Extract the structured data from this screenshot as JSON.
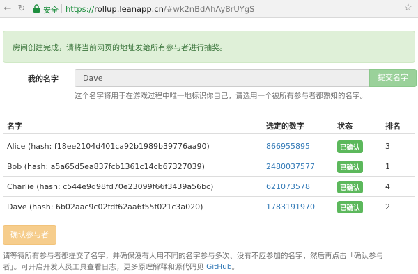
{
  "browser": {
    "secure_label": "安全",
    "url_protocol": "https://",
    "url_domain": "rollup.leanapp.cn",
    "url_hash": "/#wk2nBdAhAy8rUYgS"
  },
  "alert": {
    "text": "房间创建完成，请将当前网页的地址发给所有参与者进行抽奖。"
  },
  "form": {
    "name_label": "我的名字",
    "name_value": "Dave",
    "submit_label": "提交名字",
    "help_text": "这个名字将用于在游戏过程中唯一地标识你自己，请选用一个被所有参与者都熟知的名字。"
  },
  "table": {
    "headers": {
      "name": "名字",
      "number": "选定的数字",
      "status": "状态",
      "rank": "排名"
    },
    "rows": [
      {
        "name": "Alice (hash: f18ee2104d401ca92b1989b39776aa90)",
        "number": "866955895",
        "status": "已确认",
        "rank": "3"
      },
      {
        "name": "Bob (hash: a5a65d5ea837fcb1361c14cb67327039)",
        "number": "2480037577",
        "status": "已确认",
        "rank": "1"
      },
      {
        "name": "Charlie (hash: c544e9d98fd70e23099f66f3439a56bc)",
        "number": "621073578",
        "status": "已确认",
        "rank": "4"
      },
      {
        "name": "Dave (hash: 6b02aac9c02fdf62aa6f55f021c3a020)",
        "number": "1783191970",
        "status": "已确认",
        "rank": "2"
      }
    ]
  },
  "confirm_button": "确认参与者",
  "footer": {
    "text_line1": "请等待所有参与者都提交了名字，并确保没有人用不同的名字参与多次、没有不应参加的名字，然后再点击「确认参与",
    "text_line2": "者」。可开启开发人员工具查看日志，更多原理解释和源代码见 ",
    "link": "GitHub",
    "text_end": "。"
  },
  "colors": {
    "alert_bg": "#dff0d8",
    "success_green": "#5cb85c",
    "link_blue": "#337ab7",
    "warning_orange": "#f6cd8c"
  }
}
